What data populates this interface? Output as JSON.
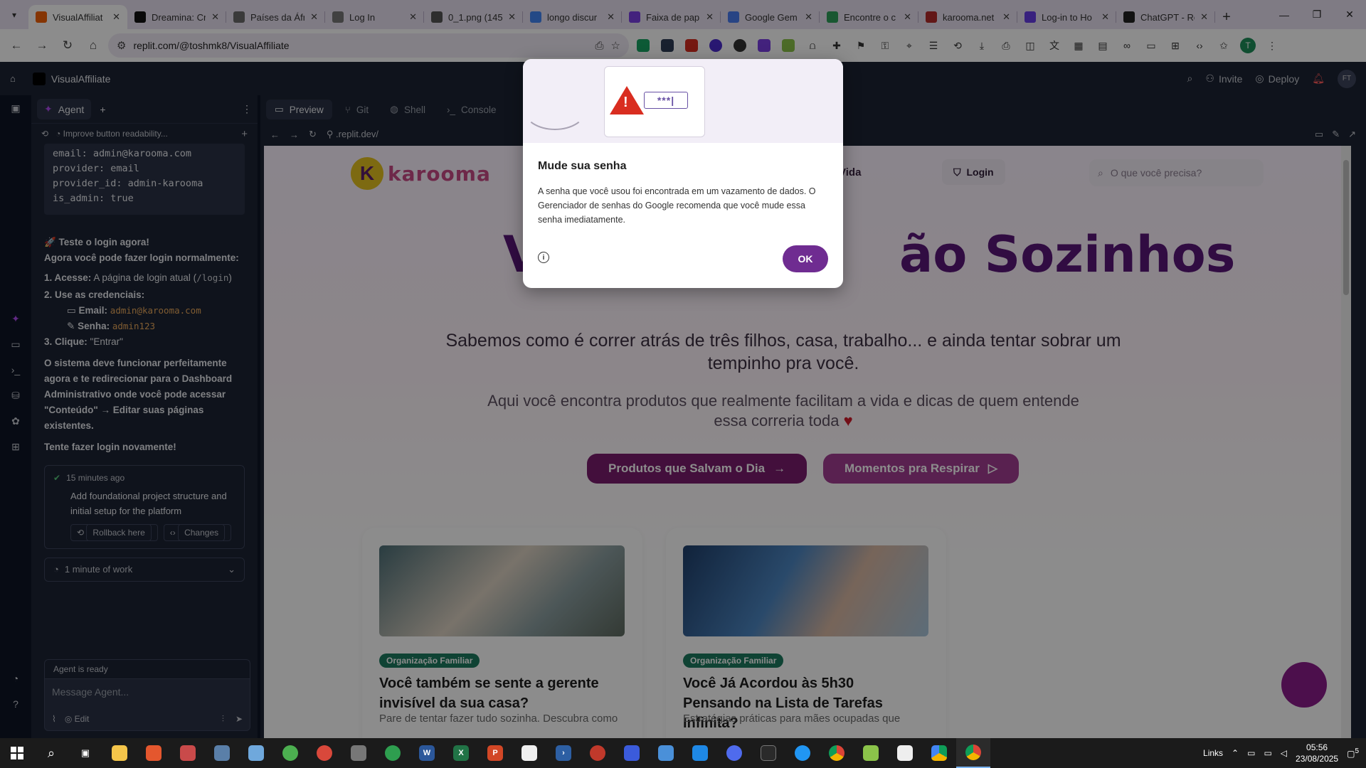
{
  "browser": {
    "tabs": [
      {
        "title": "VisualAffiliat",
        "favicon": "replit-icon",
        "color": "#f26207",
        "active": true
      },
      {
        "title": "Dreamina: Cr",
        "favicon": "dreamina-icon",
        "color": "#111111"
      },
      {
        "title": "Países da Áfr",
        "favicon": "bing-icon",
        "color": "#6b6b6b"
      },
      {
        "title": "Log In",
        "favicon": "login-icon",
        "color": "#777777"
      },
      {
        "title": "0_1.png (145",
        "favicon": "globe-icon",
        "color": "#555555"
      },
      {
        "title": "longo discur",
        "favicon": "google-icon",
        "color": "#4285f4"
      },
      {
        "title": "Faixa de pap",
        "favicon": "forms-icon",
        "color": "#7b3fe4"
      },
      {
        "title": "Google Gem",
        "favicon": "gemini-icon",
        "color": "#4a7df0"
      },
      {
        "title": "Encontre o c",
        "favicon": "shop-icon",
        "color": "#2e9e5a"
      },
      {
        "title": "karooma.net",
        "favicon": "karooma-icon",
        "color": "#b32b2b"
      },
      {
        "title": "Log-in to Ho",
        "favicon": "hostinger-icon",
        "color": "#673de6"
      },
      {
        "title": "ChatGPT - Re",
        "favicon": "chatgpt-icon",
        "color": "#222222"
      }
    ],
    "url": "replit.com/@toshmk8/VisualAffiliate",
    "profile_initial": "T"
  },
  "replit": {
    "project_name": "VisualAffiliate",
    "invite_label": "Invite",
    "deploy_label": "Deploy",
    "user_initials": "FT",
    "agent_tab": "Agent",
    "thread_title": "Improve button readability...",
    "code_lines": "email: admin@karooma.com\nprovider: email\nprovider_id: admin-karooma\nis_admin: true",
    "msg": {
      "test_title": "🚀 Teste o login agora!",
      "test_sub": "Agora você pode fazer login normalmente:",
      "step1_label": "1. Acesse:",
      "step1_text": "A página de login atual (",
      "step1_code": "/login",
      "step1_end": ")",
      "step2_label": "2. Use as credenciais:",
      "email_label": "Email:",
      "email_value": "admin@karooma.com",
      "senha_label": "Senha:",
      "senha_value": "admin123",
      "step3_label": "3. Clique:",
      "step3_text": "\"Entrar\"",
      "para1": "O sistema deve funcionar perfeitamente agora e te redirecionar para o Dashboard Administrativo onde você pode acessar \"Conteúdo\" → Editar suas páginas existentes.",
      "para2": "Tente fazer login novamente!"
    },
    "checkpoint": {
      "time": "15 minutes ago",
      "text": "Add foundational project structure and initial setup for the platform",
      "rollback": "Rollback here",
      "changes": "Changes"
    },
    "work_time": "1 minute of work",
    "agent_status": "Agent is ready",
    "composer_placeholder": "Message Agent...",
    "composer_edit": "Edit",
    "preview_tabs": [
      "Preview",
      "Git",
      "Shell",
      "Console"
    ],
    "preview_url": ".replit.dev/"
  },
  "site": {
    "logo_text": "karooma",
    "nav_item": "Vida",
    "login": "Login",
    "search_placeholder": "O que você precisa?",
    "hero_left": "V",
    "hero_right": "ão Sozinhos",
    "hero_sub": "Sabemos como é correr atrás de três filhos, casa, trabalho... e ainda tentar sobrar um tempinho pra você.",
    "hero_sub2": "Aqui você encontra produtos que realmente facilitam a vida e dicas de quem entende essa correria toda",
    "cta1": "Produtos que Salvam o Dia",
    "cta2": "Momentos pra Respirar",
    "posts": [
      {
        "tag": "Organização Familiar",
        "title": "Você também se sente a gerente invisível da sua casa?",
        "excerpt": "Pare de tentar fazer tudo sozinha. Descubra como"
      },
      {
        "tag": "Organização Familiar",
        "title": "Você Já Acordou às 5h30 Pensando na Lista de Tarefas Infinita?",
        "excerpt": "Estratégias práticas para mães ocupadas que"
      }
    ]
  },
  "dialog": {
    "title": "Mude sua senha",
    "body": "A senha que você usou foi encontrada em um vazamento de dados. O Gerenciador de senhas do Google recomenda que você mude essa senha imediatamente.",
    "ok": "OK",
    "password_mask": "***|"
  },
  "taskbar": {
    "tray_label": "Links",
    "time": "05:56",
    "date": "23/08/2025",
    "notif_count": "5"
  }
}
